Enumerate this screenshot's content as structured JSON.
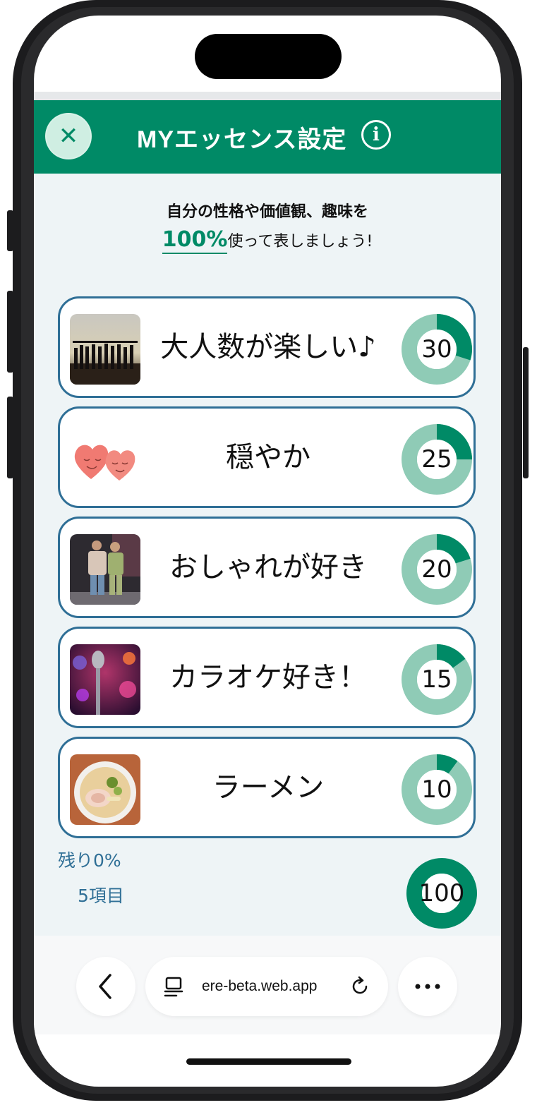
{
  "header": {
    "title": "MYエッセンス設定",
    "close_symbol": "✕",
    "info_symbol": "i"
  },
  "intro": {
    "line1": "自分の性格や価値観、趣味を",
    "percent": "100%",
    "line2_rest": "使って表しましょう!"
  },
  "essences": [
    {
      "label": "大人数が楽しい♪",
      "value": 30,
      "icon": "crowd-sunset-photo"
    },
    {
      "label": "穏やか",
      "value": 25,
      "icon": "smiling-hearts-illustration"
    },
    {
      "label": "おしゃれが好き",
      "value": 20,
      "icon": "fashion-couple-photo"
    },
    {
      "label": "カラオケ好き！",
      "value": 15,
      "icon": "microphone-photo"
    },
    {
      "label": "ラーメン",
      "value": 10,
      "icon": "ramen-bowl-photo"
    }
  ],
  "summary": {
    "remaining": "残り0%",
    "items": "5項目",
    "total": 100
  },
  "browser": {
    "url": "ere-beta.web.app"
  },
  "colors": {
    "header_bg": "#008a66",
    "donut_fill": "#008a66",
    "donut_track": "#8fcbb6",
    "card_border": "#2f6f96",
    "content_bg": "#eef4f6"
  }
}
